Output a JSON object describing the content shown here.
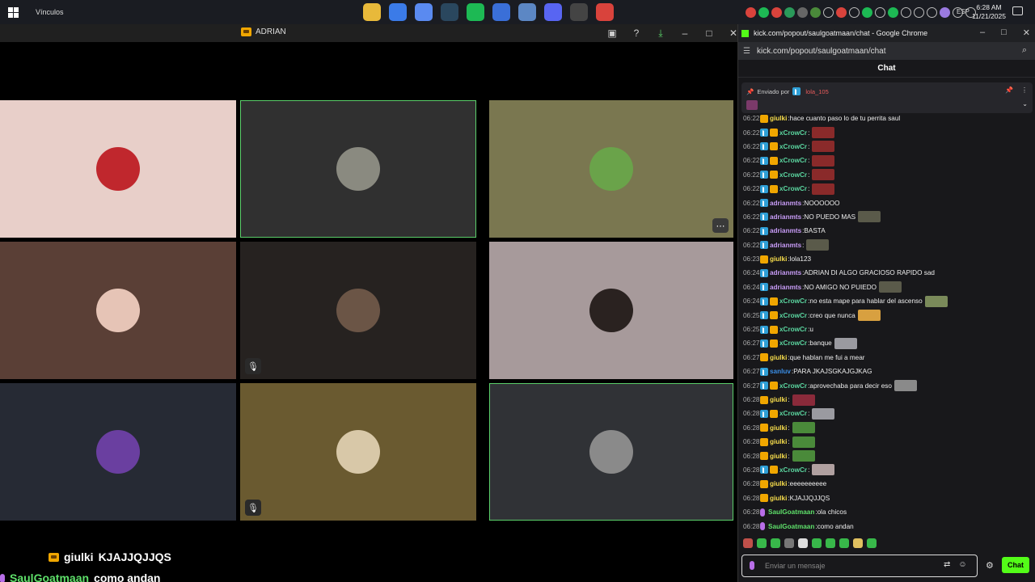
{
  "taskbar": {
    "links_label": "Vínculos",
    "language": "ESP",
    "time": "6:28 AM",
    "date": "11/21/2025",
    "pinned_apps": [
      {
        "icon": "file-explorer-icon",
        "color": "#e8b93a"
      },
      {
        "icon": "chrome-icon",
        "color": "#3b7be8"
      },
      {
        "icon": "copilot-icon",
        "color": "#5a8af0"
      },
      {
        "icon": "steam-icon",
        "color": "#2a475e"
      },
      {
        "icon": "spotify-icon",
        "color": "#1db954"
      },
      {
        "icon": "store-icon",
        "color": "#3a6fd8"
      },
      {
        "icon": "mail-icon",
        "color": "#5c87c4"
      },
      {
        "icon": "discord-icon",
        "color": "#5865f2"
      },
      {
        "icon": "obs-icon",
        "color": "#444444"
      },
      {
        "icon": "chrome-canary-icon",
        "color": "#d9433c"
      }
    ]
  },
  "call_window": {
    "title": "ADRIAN",
    "tiles": [
      {
        "bg": "#e8cfc9",
        "avatar": "#c0272d",
        "highlighted": false,
        "muted": false,
        "more": false
      },
      {
        "bg": "#303030",
        "avatar": "#8a8a80",
        "highlighted": true,
        "muted": false,
        "more": false
      },
      {
        "bg": "#7a7750",
        "avatar": "#6aa34a",
        "highlighted": false,
        "muted": false,
        "more": true
      },
      {
        "bg": "#5a3f36",
        "avatar": "#e6c4b6",
        "highlighted": false,
        "muted": false,
        "more": false
      },
      {
        "bg": "#262220",
        "avatar": "#6b5546",
        "highlighted": false,
        "muted": true,
        "more": false
      },
      {
        "bg": "#a79a9b",
        "avatar": "#2a2220",
        "highlighted": false,
        "muted": false,
        "more": false
      },
      {
        "bg": "#262a34",
        "avatar": "#6a3fa0",
        "highlighted": false,
        "muted": false,
        "more": false
      },
      {
        "bg": "#6a5a30",
        "avatar": "#d8c8a8",
        "highlighted": false,
        "muted": true,
        "more": false
      },
      {
        "bg": "#303236",
        "avatar": "#8a8a8a",
        "highlighted": true,
        "muted": false,
        "more": false
      }
    ]
  },
  "overlay_chat": [
    {
      "user": "giulki",
      "text": "KJAJJQJJQS",
      "badge": "crown"
    },
    {
      "user": "SaulGoatmaan",
      "text": "como andan",
      "badge": "mic"
    },
    {
      "user": "SaulGoatmaan",
      "text": "ola chicos",
      "badge": "mic"
    }
  ],
  "chat_window": {
    "title": "kick.com/popout/saulgoatmaan/chat - Google Chrome",
    "url": "kick.com/popout/saulgoatmaan/chat",
    "header": "Chat",
    "pinned": {
      "prefix": "Enviado por",
      "user": "lola_105"
    },
    "messages": [
      {
        "time": "06:22",
        "user": "giulki",
        "cls": "g",
        "badges": [
          "crown"
        ],
        "text": "hace cuanto paso lo de tu perrita saul",
        "emote": ""
      },
      {
        "time": "06:22",
        "user": "xCrowCr",
        "cls": "c",
        "badges": [
          "kick",
          "crown"
        ],
        "text": "",
        "emote": "#8a2a2a"
      },
      {
        "time": "06:22",
        "user": "xCrowCr",
        "cls": "c",
        "badges": [
          "kick",
          "crown"
        ],
        "text": "",
        "emote": "#8a2a2a"
      },
      {
        "time": "06:22",
        "user": "xCrowCr",
        "cls": "c",
        "badges": [
          "kick",
          "crown"
        ],
        "text": "",
        "emote": "#8a2a2a"
      },
      {
        "time": "06:22",
        "user": "xCrowCr",
        "cls": "c",
        "badges": [
          "kick",
          "crown"
        ],
        "text": "",
        "emote": "#8a2a2a"
      },
      {
        "time": "06:22",
        "user": "xCrowCr",
        "cls": "c",
        "badges": [
          "kick",
          "crown"
        ],
        "text": "",
        "emote": "#8a2a2a"
      },
      {
        "time": "06:22",
        "user": "adrianmts",
        "cls": "a",
        "badges": [
          "kick"
        ],
        "text": "NOOOOOO",
        "emote": ""
      },
      {
        "time": "06:22",
        "user": "adrianmts",
        "cls": "a",
        "badges": [
          "kick"
        ],
        "text": "NO PUEDO MAS",
        "emote": "#5a5a4a"
      },
      {
        "time": "06:22",
        "user": "adrianmts",
        "cls": "a",
        "badges": [
          "kick"
        ],
        "text": "BASTA",
        "emote": ""
      },
      {
        "time": "06:22",
        "user": "adrianmts",
        "cls": "a",
        "badges": [
          "kick"
        ],
        "text": "",
        "emote": "#5a5a4a"
      },
      {
        "time": "06:23",
        "user": "giulki",
        "cls": "g",
        "badges": [
          "crown"
        ],
        "text": "lola123",
        "emote": ""
      },
      {
        "time": "06:24",
        "user": "adrianmts",
        "cls": "a",
        "badges": [
          "kick"
        ],
        "text": "ADRIAN DI ALGO GRACIOSO RAPIDO sad",
        "emote": ""
      },
      {
        "time": "06:24",
        "user": "adrianmts",
        "cls": "a",
        "badges": [
          "kick"
        ],
        "text": "NO AMIGO NO PUIEDO",
        "emote": "#5a5a4a"
      },
      {
        "time": "06:24",
        "user": "xCrowCr",
        "cls": "c",
        "badges": [
          "kick",
          "crown"
        ],
        "text": "no esta mape para hablar del ascenso",
        "emote": "#7a8a5a"
      },
      {
        "time": "06:25",
        "user": "xCrowCr",
        "cls": "c",
        "badges": [
          "kick",
          "crown"
        ],
        "text": "creo que nunca",
        "emote": "#d8a040"
      },
      {
        "time": "06:25",
        "user": "xCrowCr",
        "cls": "c",
        "badges": [
          "kick",
          "crown"
        ],
        "text": "u",
        "emote": ""
      },
      {
        "time": "06:27",
        "user": "xCrowCr",
        "cls": "c",
        "badges": [
          "kick",
          "crown"
        ],
        "text": "banque",
        "emote": "#9a9aa0"
      },
      {
        "time": "06:27",
        "user": "giulki",
        "cls": "g",
        "badges": [
          "crown"
        ],
        "text": "que hablan me fui a mear",
        "emote": ""
      },
      {
        "time": "06:27",
        "user": "sanluv",
        "cls": "s",
        "badges": [
          "kick"
        ],
        "text": "PARA JKAJSGKAJGJKAG",
        "emote": ""
      },
      {
        "time": "06:27",
        "user": "xCrowCr",
        "cls": "c",
        "badges": [
          "kick",
          "crown"
        ],
        "text": "aprovechaba para decir eso",
        "emote": "#8a8a8a"
      },
      {
        "time": "06:28",
        "user": "giulki",
        "cls": "g",
        "badges": [
          "crown"
        ],
        "text": "",
        "emote": "#8a2a3a"
      },
      {
        "time": "06:28",
        "user": "xCrowCr",
        "cls": "c",
        "badges": [
          "kick",
          "crown"
        ],
        "text": "",
        "emote": "#9a9aa0"
      },
      {
        "time": "06:28",
        "user": "giulki",
        "cls": "g",
        "badges": [
          "crown"
        ],
        "text": "",
        "emote": "#4a8a3a"
      },
      {
        "time": "06:28",
        "user": "giulki",
        "cls": "g",
        "badges": [
          "crown"
        ],
        "text": "",
        "emote": "#4a8a3a"
      },
      {
        "time": "06:28",
        "user": "giulki",
        "cls": "g",
        "badges": [
          "crown"
        ],
        "text": "",
        "emote": "#4a8a3a"
      },
      {
        "time": "06:28",
        "user": "xCrowCr",
        "cls": "c",
        "badges": [
          "kick",
          "crown"
        ],
        "text": "",
        "emote": "#b0a0a0"
      },
      {
        "time": "06:28",
        "user": "giulki",
        "cls": "g",
        "badges": [
          "crown"
        ],
        "text": "eeeeeeeeee",
        "emote": ""
      },
      {
        "time": "06:28",
        "user": "giulki",
        "cls": "g",
        "badges": [
          "crown"
        ],
        "text": "KJAJJQJJQS",
        "emote": ""
      },
      {
        "time": "06:28",
        "user": "SaulGoatmaan",
        "cls": "sg",
        "badges": [
          "mic"
        ],
        "text": "ola chicos",
        "emote": ""
      },
      {
        "time": "06:28",
        "user": "SaulGoatmaan",
        "cls": "sg",
        "badges": [
          "mic"
        ],
        "text": "como andan",
        "emote": ""
      }
    ],
    "input_placeholder": "Enviar un mensaje",
    "send_label": "Chat"
  }
}
